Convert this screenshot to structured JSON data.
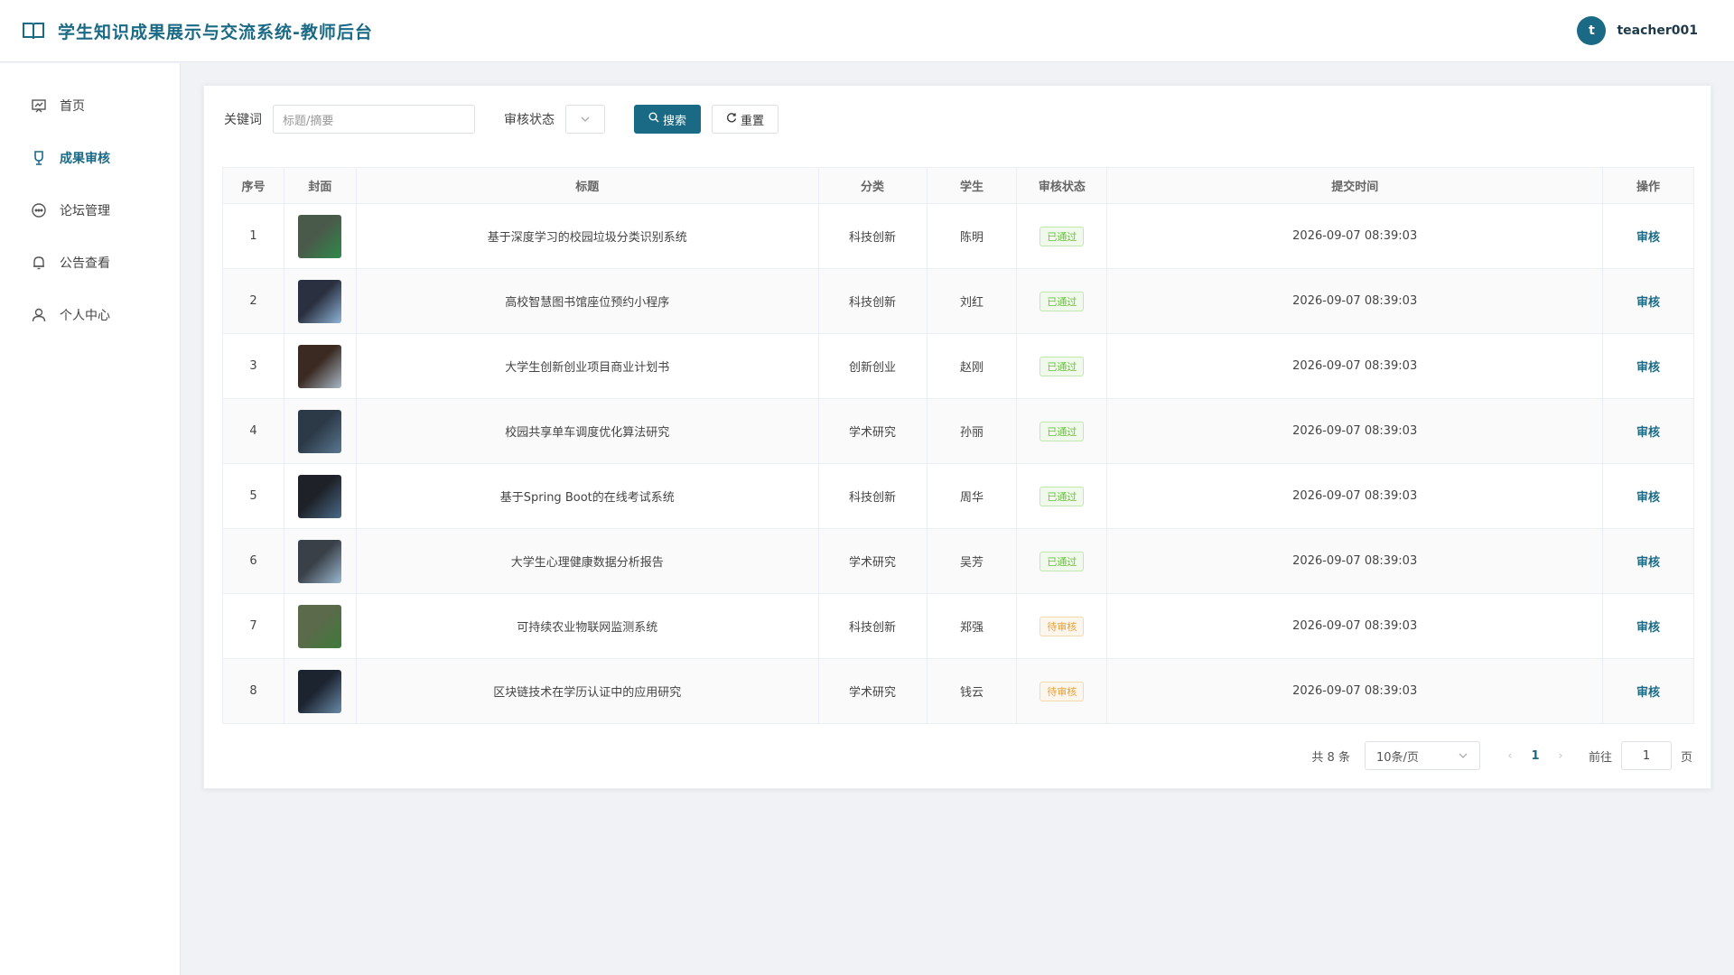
{
  "header": {
    "title": "学生知识成果展示与交流系统-教师后台",
    "user": {
      "avatar_letter": "t",
      "name": "teacher001"
    }
  },
  "sidebar": {
    "items": [
      {
        "label": "首页",
        "icon": "dashboard-icon",
        "active": false
      },
      {
        "label": "成果审核",
        "icon": "award-icon",
        "active": true
      },
      {
        "label": "论坛管理",
        "icon": "chat-icon",
        "active": false
      },
      {
        "label": "公告查看",
        "icon": "bell-icon",
        "active": false
      },
      {
        "label": "个人中心",
        "icon": "user-icon",
        "active": false
      }
    ]
  },
  "filters": {
    "keyword_label": "关键词",
    "keyword_placeholder": "标题/摘要",
    "status_label": "审核状态",
    "search_label": "搜索",
    "reset_label": "重置"
  },
  "table": {
    "columns": [
      "序号",
      "封面",
      "标题",
      "分类",
      "学生",
      "审核状态",
      "提交时间",
      "操作"
    ],
    "rows": [
      {
        "index": "1",
        "title": "基于深度学习的校园垃圾分类识别系统",
        "category": "科技创新",
        "student": "陈明",
        "status": "已通过",
        "status_type": "pass",
        "time": "2026-09-07 08:39:03",
        "action": "审核"
      },
      {
        "index": "2",
        "title": "高校智慧图书馆座位预约小程序",
        "category": "科技创新",
        "student": "刘红",
        "status": "已通过",
        "status_type": "pass",
        "time": "2026-09-07 08:39:03",
        "action": "审核"
      },
      {
        "index": "3",
        "title": "大学生创新创业项目商业计划书",
        "category": "创新创业",
        "student": "赵刚",
        "status": "已通过",
        "status_type": "pass",
        "time": "2026-09-07 08:39:03",
        "action": "审核"
      },
      {
        "index": "4",
        "title": "校园共享单车调度优化算法研究",
        "category": "学术研究",
        "student": "孙丽",
        "status": "已通过",
        "status_type": "pass",
        "time": "2026-09-07 08:39:03",
        "action": "审核"
      },
      {
        "index": "5",
        "title": "基于Spring Boot的在线考试系统",
        "category": "科技创新",
        "student": "周华",
        "status": "已通过",
        "status_type": "pass",
        "time": "2026-09-07 08:39:03",
        "action": "审核"
      },
      {
        "index": "6",
        "title": "大学生心理健康数据分析报告",
        "category": "学术研究",
        "student": "吴芳",
        "status": "已通过",
        "status_type": "pass",
        "time": "2026-09-07 08:39:03",
        "action": "审核"
      },
      {
        "index": "7",
        "title": "可持续农业物联网监测系统",
        "category": "科技创新",
        "student": "郑强",
        "status": "待审核",
        "status_type": "wait",
        "time": "2026-09-07 08:39:03",
        "action": "审核"
      },
      {
        "index": "8",
        "title": "区块链技术在学历认证中的应用研究",
        "category": "学术研究",
        "student": "钱云",
        "status": "待审核",
        "status_type": "wait",
        "time": "2026-09-07 08:39:03",
        "action": "审核"
      }
    ]
  },
  "pagination": {
    "total_text": "共 8 条",
    "page_size": "10条/页",
    "current_page": "1",
    "goto_label": "前往",
    "goto_value": "1",
    "page_suffix": "页"
  },
  "colors": {
    "accent": "#1b6a85",
    "pass": "#67c23a",
    "wait": "#e6a23c"
  }
}
